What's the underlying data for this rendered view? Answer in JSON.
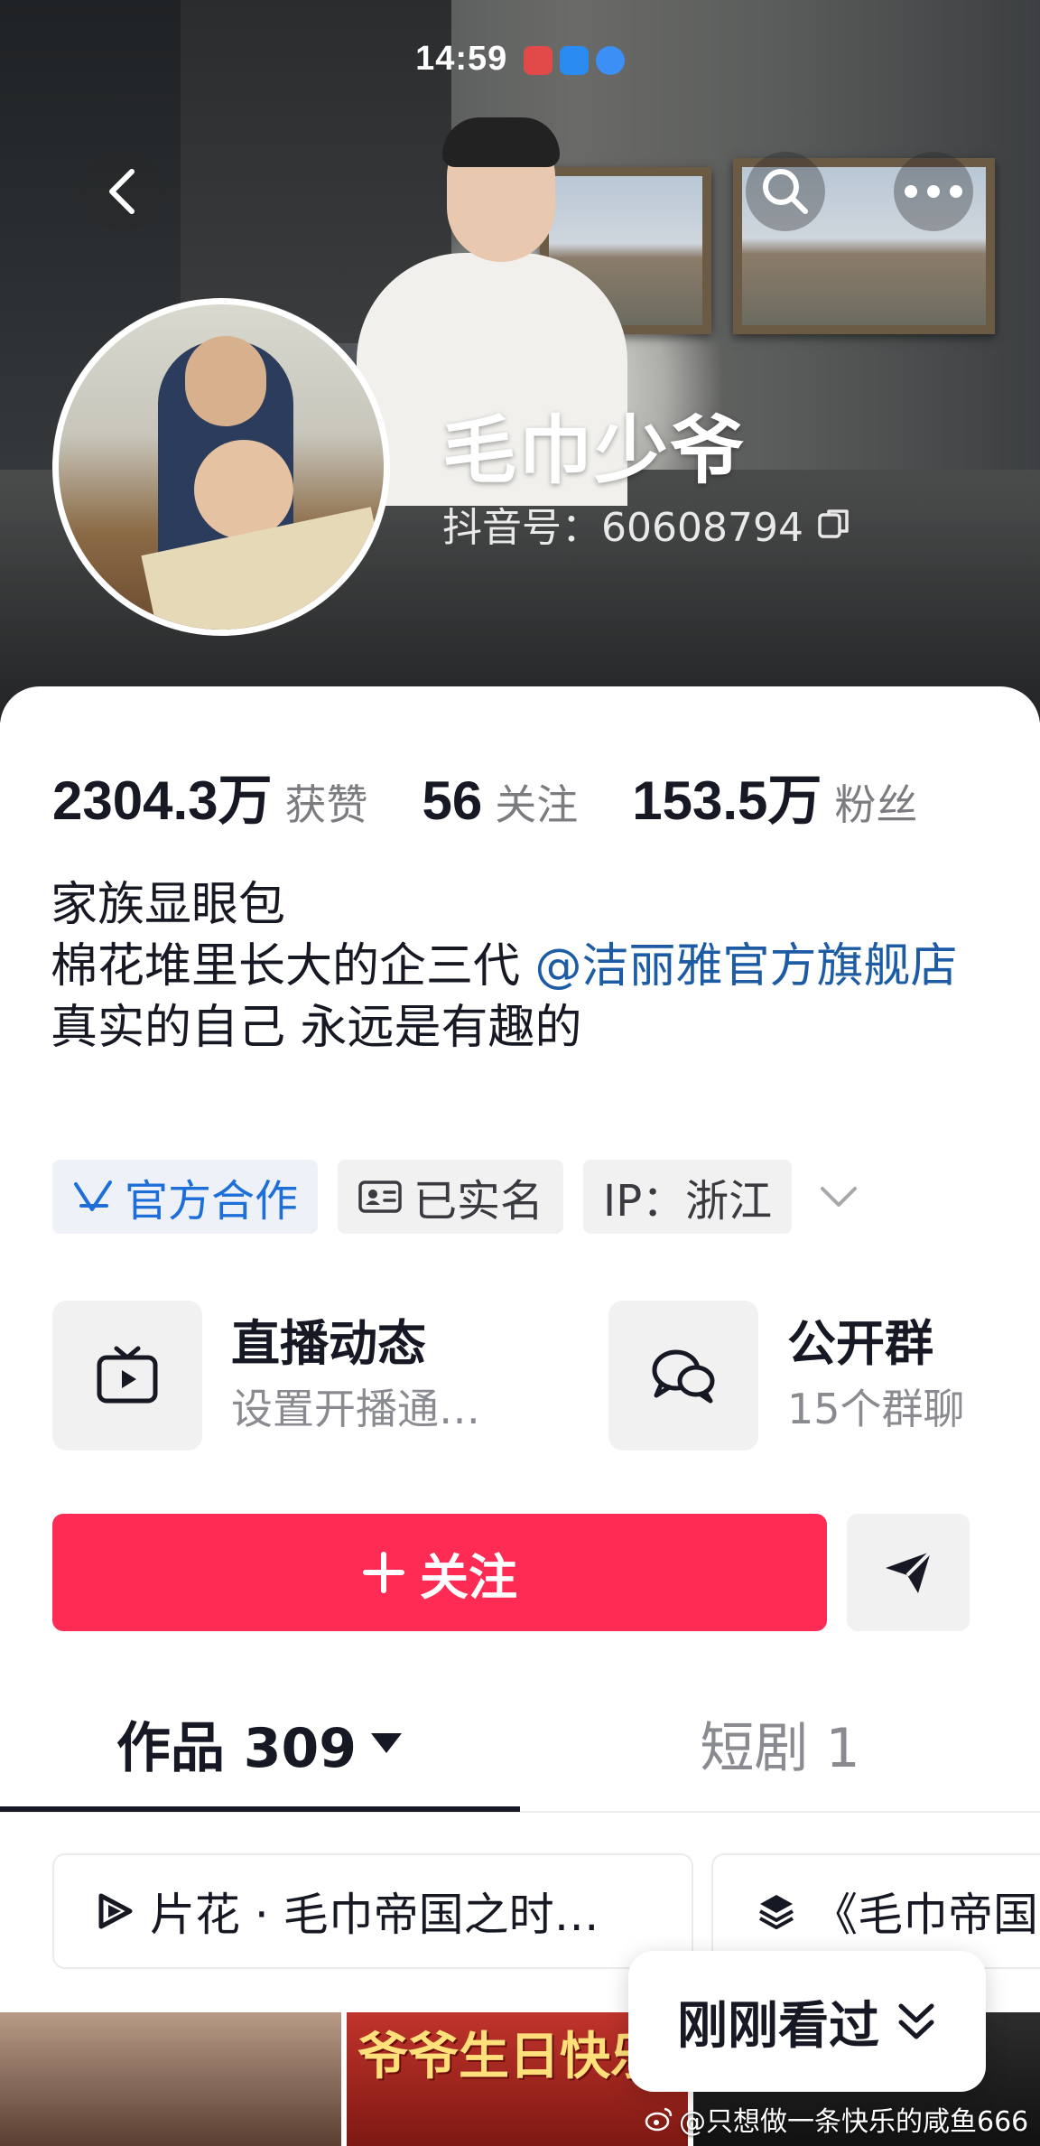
{
  "status_bar": {
    "time": "14:59"
  },
  "profile": {
    "name": "毛巾少爷",
    "douyin_id": "抖音号：60608794"
  },
  "stats": [
    {
      "value": "2304.3万",
      "label": "获赞"
    },
    {
      "value": "56",
      "label": "关注"
    },
    {
      "value": "153.5万",
      "label": "粉丝"
    }
  ],
  "bio": {
    "line1": "家族显眼包",
    "line2_prefix": "棉花堆里长大的企三代 ",
    "mention": "@洁丽雅官方旗舰店",
    "line3": "真实的自己 永远是有趣的"
  },
  "tags": {
    "official": "官方合作",
    "verified": "已实名",
    "ip": "IP：浙江"
  },
  "features": {
    "live": {
      "title": "直播动态",
      "subtitle": "设置开播通…"
    },
    "group": {
      "title": "公开群",
      "subtitle": "15个群聊"
    }
  },
  "actions": {
    "follow": "关注"
  },
  "tabs": {
    "works": "作品 309",
    "shorts": "短剧 1"
  },
  "chips": {
    "trailer": "片花 · 毛巾帝国之时…",
    "collection": "《毛巾帝国"
  },
  "recent": {
    "label": "刚刚看过"
  },
  "thumbnails": {
    "t2_text": "爷爷生日快乐"
  },
  "watermark": "@只想做一条快乐的咸鱼666",
  "colors": {
    "accent": "#fe2c55",
    "link": "#1d5ba4",
    "official": "#1d6ed8"
  }
}
